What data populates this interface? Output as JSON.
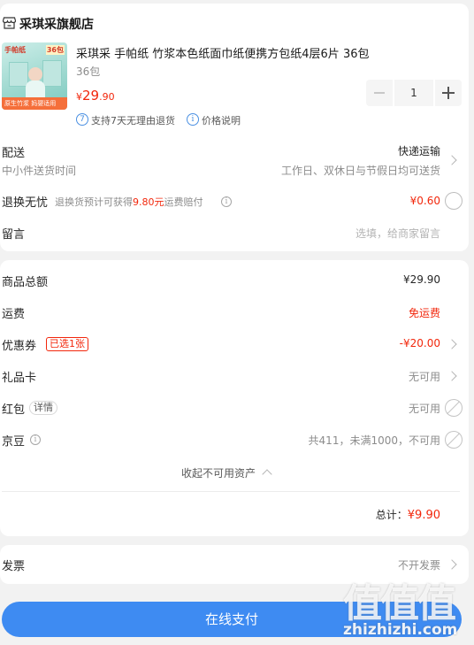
{
  "shop": {
    "name": "采琪采旗舰店"
  },
  "product": {
    "title": "采琪采 手帕纸 竹浆本色纸面巾纸便携方包纸4层6片 36包",
    "spec": "36包",
    "price_symbol": "¥",
    "price_int": "29",
    "price_dec": ".90",
    "quantity": "1",
    "thumb_label_tl": "手帕纸",
    "thumb_label_tr": "36包",
    "thumb_band": "原生竹浆 妈婴适用",
    "service_return": "支持7天无理由退货",
    "service_price": "价格说明"
  },
  "delivery": {
    "label": "配送",
    "method": "快递运输",
    "sub": "中小件送货时间",
    "time": "工作日、双休日与节假日均可送货"
  },
  "return_worry": {
    "label": "退换无忧",
    "desc_prefix": "退换货预计可获得",
    "desc_amount": "9.80元",
    "desc_suffix": "运费赔付",
    "price": "¥0.60"
  },
  "message": {
    "label": "留言",
    "placeholder": "选填，给商家留言"
  },
  "summary": {
    "goods_total_label": "商品总额",
    "goods_total": "¥29.90",
    "freight_label": "运费",
    "freight": "免运费",
    "coupon_label": "优惠券",
    "coupon_tag": "已选1张",
    "coupon_value": "-¥20.00",
    "giftcard_label": "礼品卡",
    "giftcard_value": "无可用",
    "redpacket_label": "红包",
    "redpacket_detail": "详情",
    "redpacket_value": "无可用",
    "jd_bean_label": "京豆",
    "jd_bean_value": "共411，未满1000，不可用",
    "collapse_label": "收起不可用资产",
    "total_label": "总计：",
    "total_value": "¥9.90"
  },
  "invoice": {
    "label": "发票",
    "value": "不开发票"
  },
  "pay_button": "在线支付",
  "watermark": {
    "mark": "值值值",
    "domain": "zhizhizhi.com"
  },
  "colors": {
    "accent_red": "#f2270c",
    "pay_blue": "#3e8bf2",
    "service_blue": "#4a90e2"
  }
}
